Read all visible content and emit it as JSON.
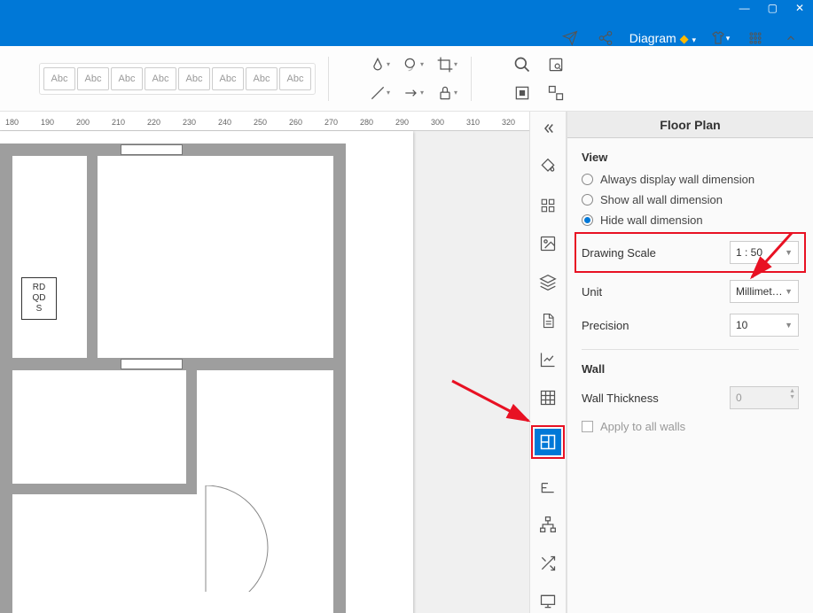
{
  "titlebar": {
    "menu_label": "Diagram"
  },
  "toolbar": {
    "chip": "Abc"
  },
  "ruler": {
    "ticks": [
      "180",
      "190",
      "200",
      "210",
      "220",
      "230",
      "240",
      "250",
      "260",
      "270",
      "280",
      "290",
      "300",
      "310",
      "320"
    ]
  },
  "canvas": {
    "tag_lines": [
      "RD",
      "QD",
      "S"
    ]
  },
  "panel": {
    "title": "Floor Plan",
    "view": {
      "heading": "View",
      "opt1": "Always display wall dimension",
      "opt2": "Show all wall dimension",
      "opt3": "Hide wall dimension",
      "selected": 2
    },
    "scale": {
      "label": "Drawing Scale",
      "value": "1 : 50"
    },
    "unit": {
      "label": "Unit",
      "value": "Millimet…"
    },
    "precision": {
      "label": "Precision",
      "value": "10"
    },
    "wall": {
      "heading": "Wall",
      "thickness_label": "Wall Thickness",
      "thickness_value": "0",
      "apply_all": "Apply to all walls"
    }
  }
}
